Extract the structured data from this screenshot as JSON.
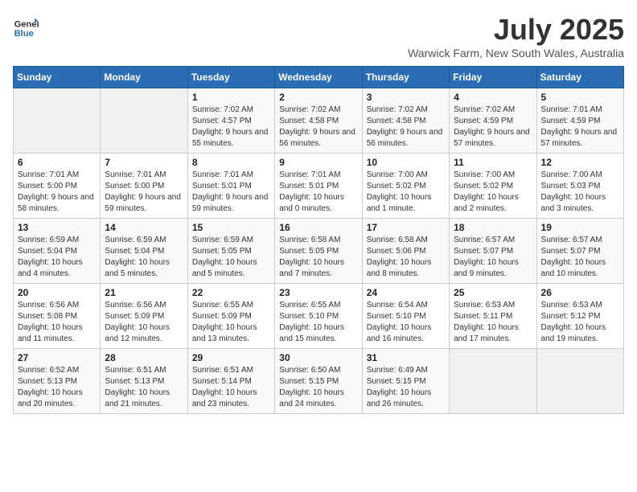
{
  "logo": {
    "line1": "General",
    "line2": "Blue"
  },
  "title": "July 2025",
  "location": "Warwick Farm, New South Wales, Australia",
  "weekdays": [
    "Sunday",
    "Monday",
    "Tuesday",
    "Wednesday",
    "Thursday",
    "Friday",
    "Saturday"
  ],
  "weeks": [
    [
      {
        "day": "",
        "info": ""
      },
      {
        "day": "",
        "info": ""
      },
      {
        "day": "1",
        "info": "Sunrise: 7:02 AM\nSunset: 4:57 PM\nDaylight: 9 hours and 55 minutes."
      },
      {
        "day": "2",
        "info": "Sunrise: 7:02 AM\nSunset: 4:58 PM\nDaylight: 9 hours and 56 minutes."
      },
      {
        "day": "3",
        "info": "Sunrise: 7:02 AM\nSunset: 4:58 PM\nDaylight: 9 hours and 56 minutes."
      },
      {
        "day": "4",
        "info": "Sunrise: 7:02 AM\nSunset: 4:59 PM\nDaylight: 9 hours and 57 minutes."
      },
      {
        "day": "5",
        "info": "Sunrise: 7:01 AM\nSunset: 4:59 PM\nDaylight: 9 hours and 57 minutes."
      }
    ],
    [
      {
        "day": "6",
        "info": "Sunrise: 7:01 AM\nSunset: 5:00 PM\nDaylight: 9 hours and 58 minutes."
      },
      {
        "day": "7",
        "info": "Sunrise: 7:01 AM\nSunset: 5:00 PM\nDaylight: 9 hours and 59 minutes."
      },
      {
        "day": "8",
        "info": "Sunrise: 7:01 AM\nSunset: 5:01 PM\nDaylight: 9 hours and 59 minutes."
      },
      {
        "day": "9",
        "info": "Sunrise: 7:01 AM\nSunset: 5:01 PM\nDaylight: 10 hours and 0 minutes."
      },
      {
        "day": "10",
        "info": "Sunrise: 7:00 AM\nSunset: 5:02 PM\nDaylight: 10 hours and 1 minute."
      },
      {
        "day": "11",
        "info": "Sunrise: 7:00 AM\nSunset: 5:02 PM\nDaylight: 10 hours and 2 minutes."
      },
      {
        "day": "12",
        "info": "Sunrise: 7:00 AM\nSunset: 5:03 PM\nDaylight: 10 hours and 3 minutes."
      }
    ],
    [
      {
        "day": "13",
        "info": "Sunrise: 6:59 AM\nSunset: 5:04 PM\nDaylight: 10 hours and 4 minutes."
      },
      {
        "day": "14",
        "info": "Sunrise: 6:59 AM\nSunset: 5:04 PM\nDaylight: 10 hours and 5 minutes."
      },
      {
        "day": "15",
        "info": "Sunrise: 6:59 AM\nSunset: 5:05 PM\nDaylight: 10 hours and 5 minutes."
      },
      {
        "day": "16",
        "info": "Sunrise: 6:58 AM\nSunset: 5:05 PM\nDaylight: 10 hours and 7 minutes."
      },
      {
        "day": "17",
        "info": "Sunrise: 6:58 AM\nSunset: 5:06 PM\nDaylight: 10 hours and 8 minutes."
      },
      {
        "day": "18",
        "info": "Sunrise: 6:57 AM\nSunset: 5:07 PM\nDaylight: 10 hours and 9 minutes."
      },
      {
        "day": "19",
        "info": "Sunrise: 6:57 AM\nSunset: 5:07 PM\nDaylight: 10 hours and 10 minutes."
      }
    ],
    [
      {
        "day": "20",
        "info": "Sunrise: 6:56 AM\nSunset: 5:08 PM\nDaylight: 10 hours and 11 minutes."
      },
      {
        "day": "21",
        "info": "Sunrise: 6:56 AM\nSunset: 5:09 PM\nDaylight: 10 hours and 12 minutes."
      },
      {
        "day": "22",
        "info": "Sunrise: 6:55 AM\nSunset: 5:09 PM\nDaylight: 10 hours and 13 minutes."
      },
      {
        "day": "23",
        "info": "Sunrise: 6:55 AM\nSunset: 5:10 PM\nDaylight: 10 hours and 15 minutes."
      },
      {
        "day": "24",
        "info": "Sunrise: 6:54 AM\nSunset: 5:10 PM\nDaylight: 10 hours and 16 minutes."
      },
      {
        "day": "25",
        "info": "Sunrise: 6:53 AM\nSunset: 5:11 PM\nDaylight: 10 hours and 17 minutes."
      },
      {
        "day": "26",
        "info": "Sunrise: 6:53 AM\nSunset: 5:12 PM\nDaylight: 10 hours and 19 minutes."
      }
    ],
    [
      {
        "day": "27",
        "info": "Sunrise: 6:52 AM\nSunset: 5:13 PM\nDaylight: 10 hours and 20 minutes."
      },
      {
        "day": "28",
        "info": "Sunrise: 6:51 AM\nSunset: 5:13 PM\nDaylight: 10 hours and 21 minutes."
      },
      {
        "day": "29",
        "info": "Sunrise: 6:51 AM\nSunset: 5:14 PM\nDaylight: 10 hours and 23 minutes."
      },
      {
        "day": "30",
        "info": "Sunrise: 6:50 AM\nSunset: 5:15 PM\nDaylight: 10 hours and 24 minutes."
      },
      {
        "day": "31",
        "info": "Sunrise: 6:49 AM\nSunset: 5:15 PM\nDaylight: 10 hours and 26 minutes."
      },
      {
        "day": "",
        "info": ""
      },
      {
        "day": "",
        "info": ""
      }
    ]
  ]
}
